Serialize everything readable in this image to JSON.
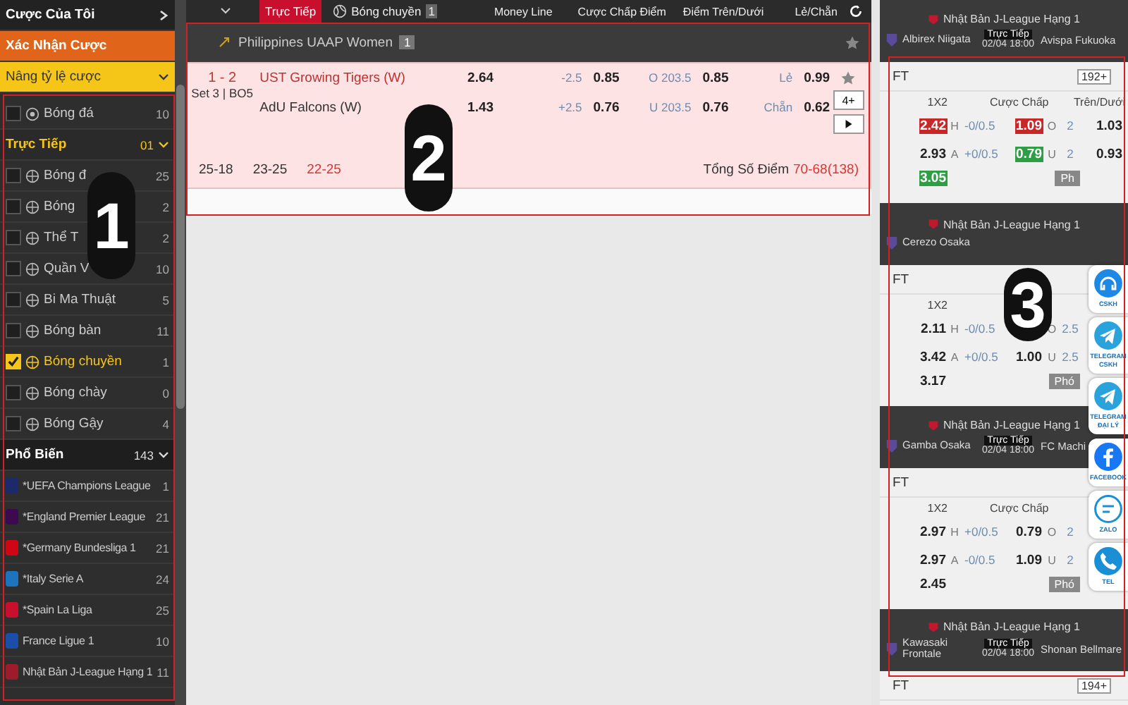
{
  "sidebar": {
    "my_bets": "Cược Của Tôi",
    "confirm_bets": "Xác Nhận Cược",
    "boost": "Nâng tỷ lệ cược",
    "top_sports": [
      {
        "name": "Bóng đá",
        "count": "10",
        "checked": false
      }
    ],
    "live": {
      "title": "Trực Tiếp",
      "count": "01"
    },
    "live_sports": [
      {
        "name": "Bóng đ",
        "count": "25",
        "checked": false
      },
      {
        "name": "Bóng",
        "count": "2",
        "checked": false
      },
      {
        "name": "Thể T",
        "count": "2",
        "checked": false
      },
      {
        "name": "Quần V",
        "count": "10",
        "checked": false
      },
      {
        "name": "Bi Ma Thuật",
        "count": "5",
        "checked": false
      },
      {
        "name": "Bóng bàn",
        "count": "11",
        "checked": false
      },
      {
        "name": "Bóng chuyền",
        "count": "1",
        "checked": true
      },
      {
        "name": "Bóng chày",
        "count": "0",
        "checked": false
      },
      {
        "name": "Bóng Gậy",
        "count": "4",
        "checked": false
      }
    ],
    "popular": {
      "title": "Phổ Biến",
      "count": "143"
    },
    "leagues": [
      {
        "name": "*UEFA Champions League",
        "count": "1",
        "color": "#1c2a6b"
      },
      {
        "name": "*England Premier League",
        "count": "21",
        "color": "#3d0a4f"
      },
      {
        "name": "*Germany Bundesliga 1",
        "count": "21",
        "color": "#d20515"
      },
      {
        "name": "*Italy Serie A",
        "count": "24",
        "color": "#1e73be"
      },
      {
        "name": "*Spain La Liga",
        "count": "25",
        "color": "#c8102e"
      },
      {
        "name": "France Ligue 1",
        "count": "10",
        "color": "#1b4ea8"
      },
      {
        "name": "Nhật Bản J-League Hạng 1",
        "count": "11",
        "color": "#9e1b2b"
      }
    ]
  },
  "header": {
    "live_tab": "Trực Tiếp",
    "sport": "Bóng chuyền",
    "sport_count": "1",
    "columns": [
      "Money Line",
      "Cược Chấp Điểm",
      "Điểm Trên/Dưới",
      "Lẻ/Chẵn"
    ]
  },
  "league": {
    "name": "Philippines UAAP Women",
    "count": "1"
  },
  "match": {
    "score": "1 - 2",
    "period": "Set 3 | BO5",
    "home": "UST Growing Tigers (W)",
    "away": "AdU Falcons (W)",
    "money_line": [
      "2.64",
      "1.43"
    ],
    "handicap": [
      {
        "line": "-2.5",
        "odds": "0.85"
      },
      {
        "line": "+2.5",
        "odds": "0.76"
      }
    ],
    "over_under": [
      {
        "line": "O 203.5",
        "odds": "0.85"
      },
      {
        "line": "U 203.5",
        "odds": "0.76"
      }
    ],
    "odd_even": [
      {
        "label": "Lẻ",
        "odds": "0.99"
      },
      {
        "label": "Chẵn",
        "odds": "0.62"
      }
    ],
    "more": "4+",
    "sets": [
      {
        "score": "25-18",
        "current": false
      },
      {
        "score": "23-25",
        "current": false
      },
      {
        "score": "22-25",
        "current": true
      }
    ],
    "total_label": "Tổng Số Điểm",
    "total_value": "70-68(138)"
  },
  "right_matches": [
    {
      "league": "Nhật Bản J-League Hạng 1",
      "home": "Albirex Niigata",
      "status": "Trực Tiếp",
      "time": "02/04 18:00",
      "away": "Avispa Fukuoka",
      "period": "FT",
      "markets": "192+",
      "columns": [
        "1X2",
        "Cược Chấp",
        "Trên/Dưới"
      ],
      "rows": [
        {
          "x12": {
            "value": "2.42",
            "color": "#c62828"
          },
          "side": "H",
          "line": "-0/0.5",
          "odds": {
            "value": "1.09",
            "color": "#c62828"
          },
          "ou_side": "O",
          "ou_line": "2",
          "ou_odds": "1.03"
        },
        {
          "x12": {
            "value": "2.93"
          },
          "side": "A",
          "line": "+0/0.5",
          "odds": {
            "value": "0.79",
            "color": "#2e9e45"
          },
          "ou_side": "U",
          "ou_line": "2",
          "ou_odds": "0.93"
        },
        {
          "x12": {
            "value": "3.05",
            "color": "#2e9e45"
          }
        }
      ],
      "more": "Ph"
    },
    {
      "league": "Nhật Bản J-League Hạng 1",
      "home": "Cerezo Osaka",
      "period": "FT",
      "columns": [
        "1X2"
      ],
      "rows": [
        {
          "x12": {
            "value": "2.11"
          },
          "side": "H",
          "line": "-0/0.5",
          "ou_side": "O",
          "ou_line": "2.5"
        },
        {
          "x12": {
            "value": "3.42"
          },
          "side": "A",
          "line": "+0/0.5",
          "odds": {
            "value": "1.00"
          },
          "ou_side": "U",
          "ou_line": "2.5"
        },
        {
          "x12": {
            "value": "3.17"
          }
        }
      ],
      "more": "Phó"
    },
    {
      "league": "Nhật Bản J-League Hạng 1",
      "home": "Gamba Osaka",
      "status": "Trực Tiếp",
      "time": "02/04 18:00",
      "away": "FC Machi",
      "period": "FT",
      "columns": [
        "1X2",
        "Cược Chấp"
      ],
      "rows": [
        {
          "x12": {
            "value": "2.97"
          },
          "side": "H",
          "line": "+0/0.5",
          "odds": {
            "value": "0.79"
          },
          "ou_side": "O",
          "ou_line": "2"
        },
        {
          "x12": {
            "value": "2.97"
          },
          "side": "A",
          "line": "-0/0.5",
          "odds": {
            "value": "1.09"
          },
          "ou_side": "U",
          "ou_line": "2"
        },
        {
          "x12": {
            "value": "2.45"
          }
        }
      ],
      "more": "Phó"
    },
    {
      "league": "Nhật Bản J-League Hạng 1",
      "home": "Kawasaki Frontale",
      "status": "Trực Tiếp",
      "time": "02/04 18:00",
      "away": "Shonan Bellmare",
      "period": "FT",
      "markets": "194+"
    }
  ],
  "contacts": [
    {
      "kind": "chat",
      "label": "CSKH",
      "color": "#1e88e5"
    },
    {
      "kind": "telegram",
      "label": "TELEGRAM CSKH",
      "color": "#2aa3dc"
    },
    {
      "kind": "telegram",
      "label": "TELEGRAM ĐẠI LÝ",
      "color": "#2aa3dc"
    },
    {
      "kind": "facebook",
      "label": "FACEBOOK",
      "color": "#1877f2"
    },
    {
      "kind": "zalo",
      "label": "ZALO",
      "color": "#1a8fd6"
    },
    {
      "kind": "phone",
      "label": "TEL",
      "color": "#1a8fd6"
    }
  ],
  "annotations": [
    {
      "label": "1"
    },
    {
      "label": "2"
    },
    {
      "label": "3"
    }
  ]
}
